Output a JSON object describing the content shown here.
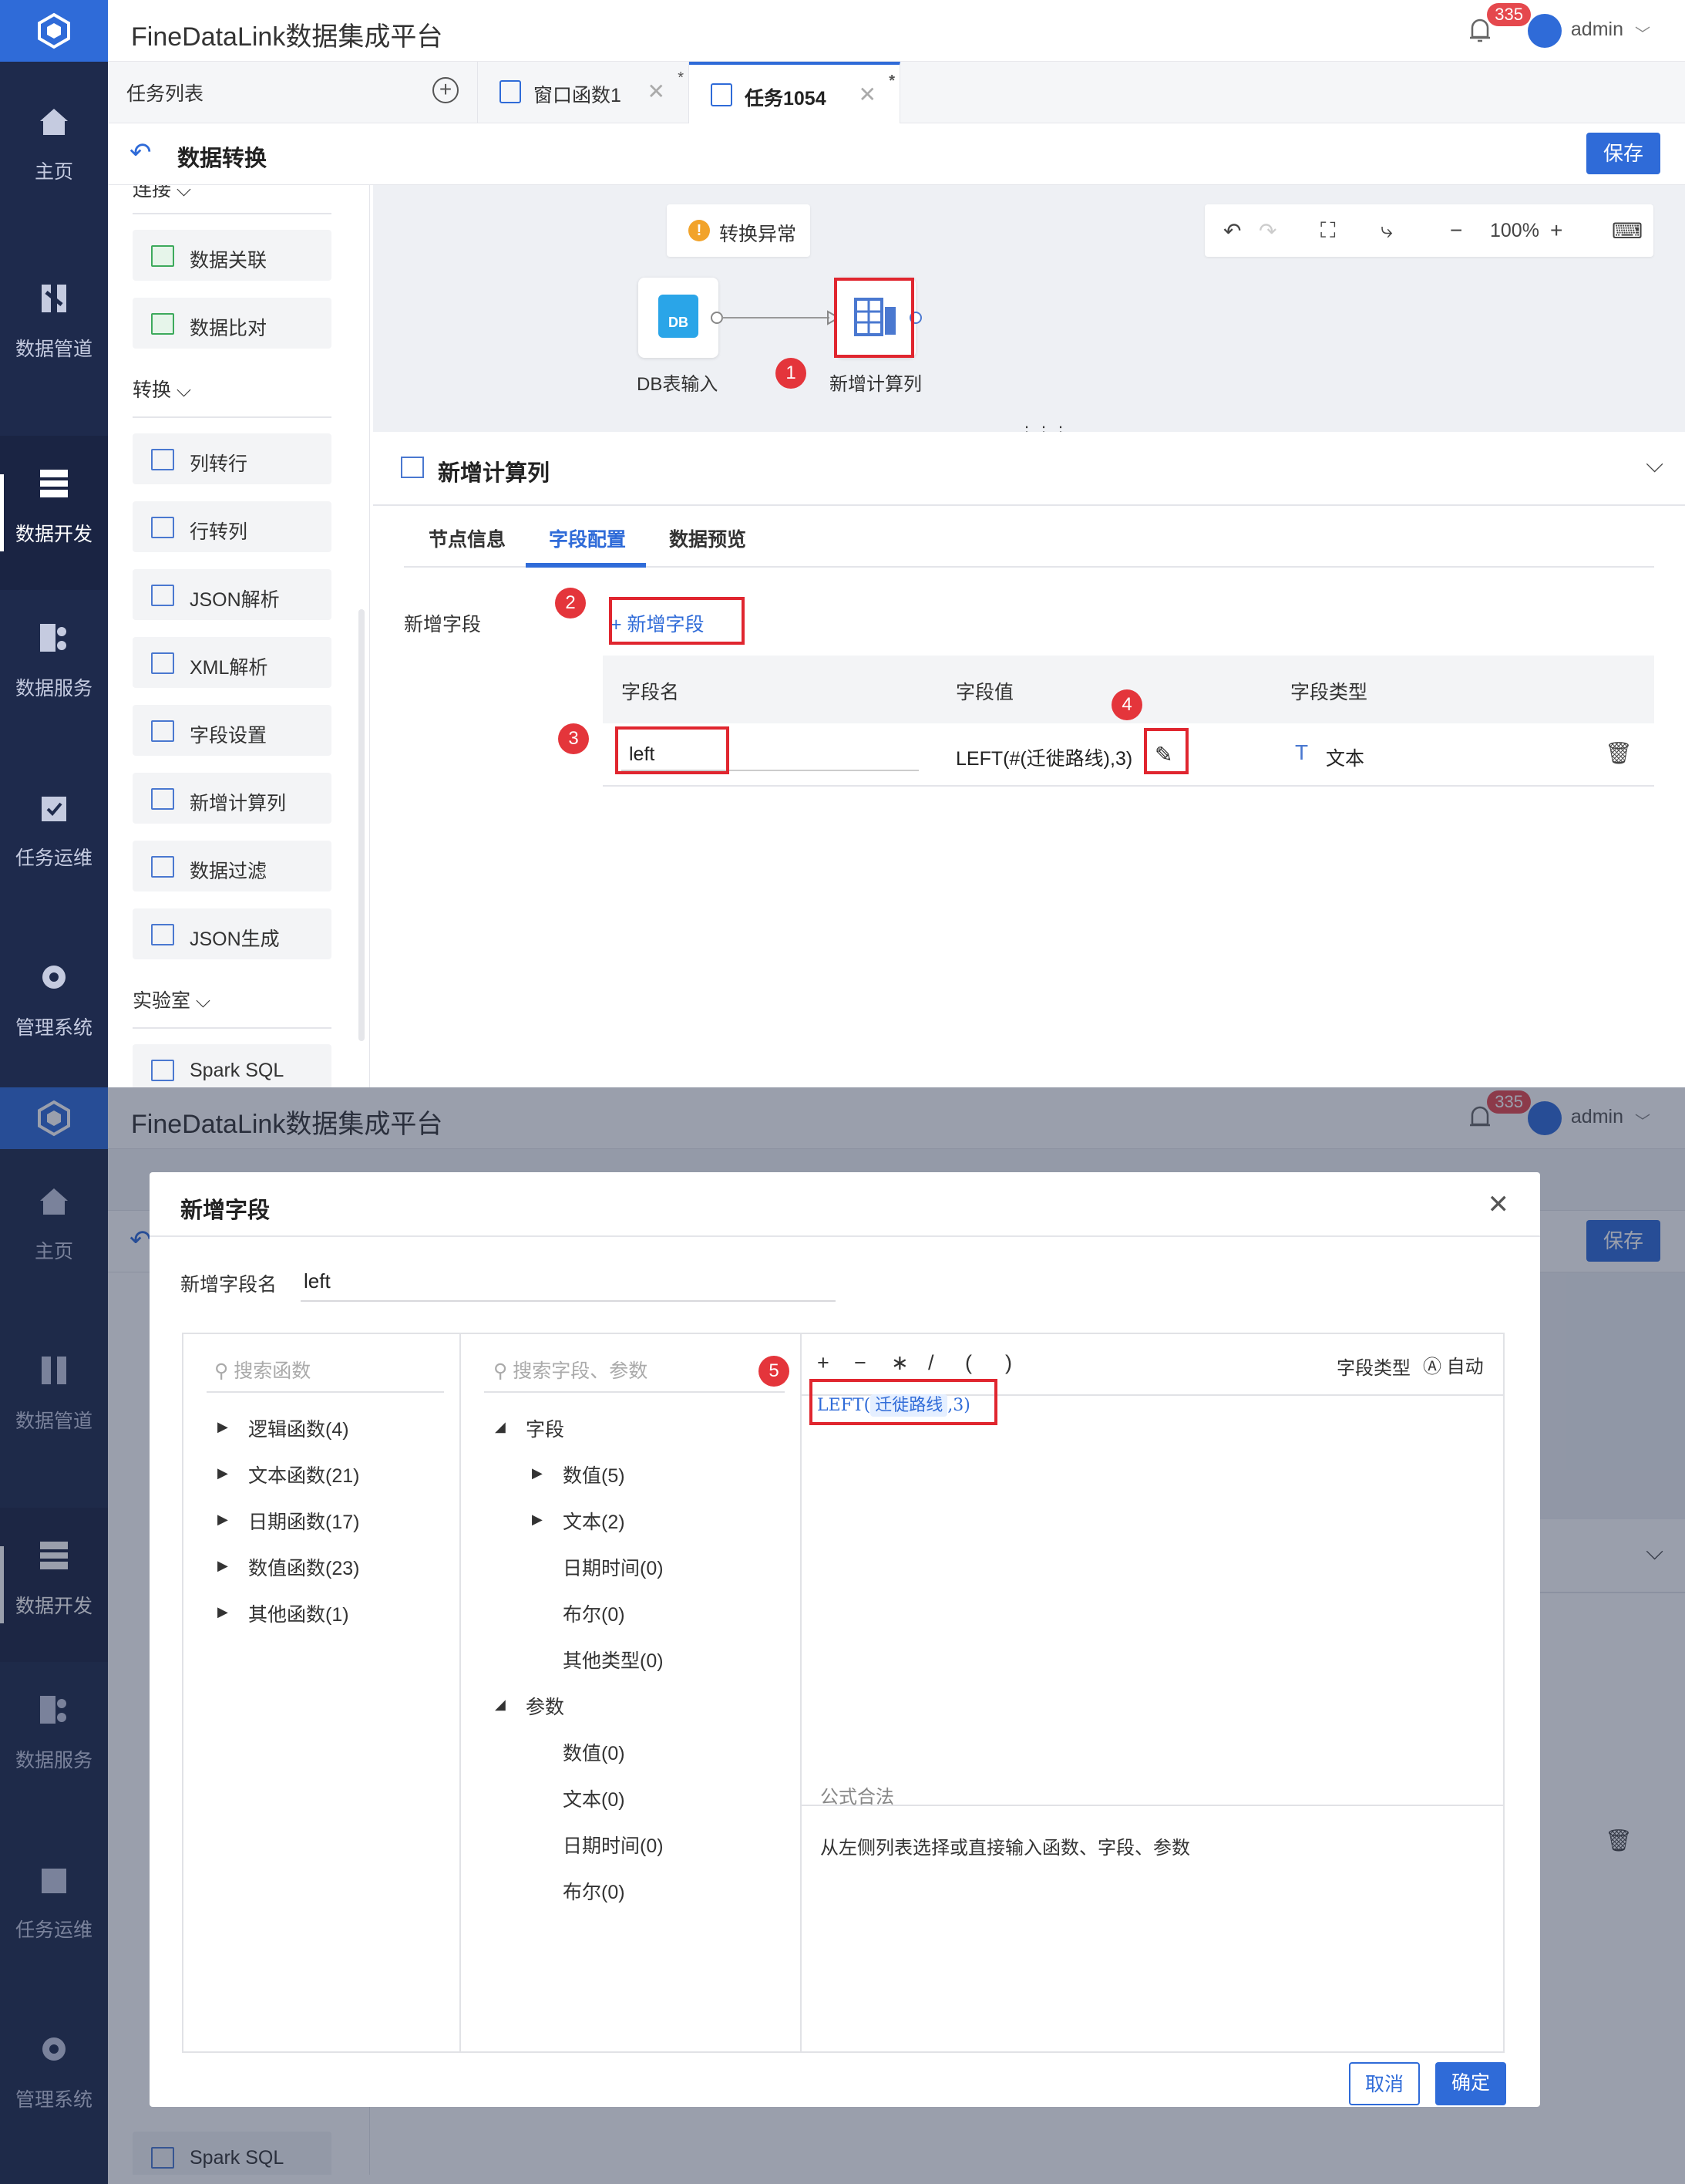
{
  "app": {
    "title": "FineDataLink数据集成平台",
    "notification_count": "335",
    "user": "admin"
  },
  "nav": [
    {
      "label": "主页",
      "icon": "home-icon"
    },
    {
      "label": "数据管道",
      "icon": "pipeline-icon"
    },
    {
      "label": "数据开发",
      "icon": "dev-icon"
    },
    {
      "label": "数据服务",
      "icon": "service-icon"
    },
    {
      "label": "任务运维",
      "icon": "ops-icon"
    },
    {
      "label": "管理系统",
      "icon": "gear-icon"
    }
  ],
  "tabs": {
    "list_label": "任务列表",
    "items": [
      {
        "label": "窗口函数1",
        "active": false
      },
      {
        "label": "任务1054",
        "active": true
      }
    ]
  },
  "page": {
    "title": "数据转换",
    "save": "保存",
    "cut_group": "连接"
  },
  "palette": {
    "groups": [
      {
        "label": "转换",
        "items": [
          "列转行",
          "行转列",
          "JSON解析",
          "XML解析",
          "字段设置",
          "新增计算列",
          "数据过滤",
          "JSON生成"
        ]
      },
      {
        "label": "实验室",
        "items": [
          "Spark SQL"
        ]
      }
    ],
    "top_items": [
      "数据关联",
      "数据比对"
    ]
  },
  "canvas": {
    "warning": "转换异常",
    "zoom": "100%",
    "nodes": [
      {
        "label": "DB表输入",
        "icon_text": "DB"
      },
      {
        "label": "新增计算列"
      }
    ]
  },
  "config": {
    "title": "新增计算列",
    "tabs": [
      "节点信息",
      "字段配置",
      "数据预览"
    ],
    "active_tab": 1,
    "field_label": "新增字段",
    "add_field": "+ 新增字段",
    "columns": [
      "字段名",
      "字段值",
      "字段类型"
    ],
    "row": {
      "name": "left",
      "value": "LEFT(#(迁徙路线),3)",
      "type": "文本"
    }
  },
  "markers": [
    "1",
    "2",
    "3",
    "4",
    "5"
  ],
  "modal": {
    "title": "新增字段",
    "name_label": "新增字段名",
    "name_value": "left",
    "func_search": "搜索函数",
    "field_search": "搜索字段、参数",
    "functions": [
      "逻辑函数(4)",
      "文本函数(21)",
      "日期函数(17)",
      "数值函数(23)",
      "其他函数(1)"
    ],
    "fields_group": "字段",
    "fields": [
      "数值(5)",
      "文本(2)",
      "日期时间(0)",
      "布尔(0)",
      "其他类型(0)"
    ],
    "params_group": "参数",
    "params": [
      "数值(0)",
      "文本(0)",
      "日期时间(0)",
      "布尔(0)"
    ],
    "ops": [
      "+",
      "−",
      "∗",
      "/",
      "(",
      ")"
    ],
    "type_label": "字段类型",
    "type_value": "自动",
    "formula_func": "LEFT",
    "formula_open": "(",
    "formula_field": "迁徙路线",
    "formula_tail": ",3)",
    "valid_label": "公式合法",
    "hint": "从左侧列表选择或直接输入函数、字段、参数",
    "cancel": "取消",
    "ok": "确定"
  }
}
